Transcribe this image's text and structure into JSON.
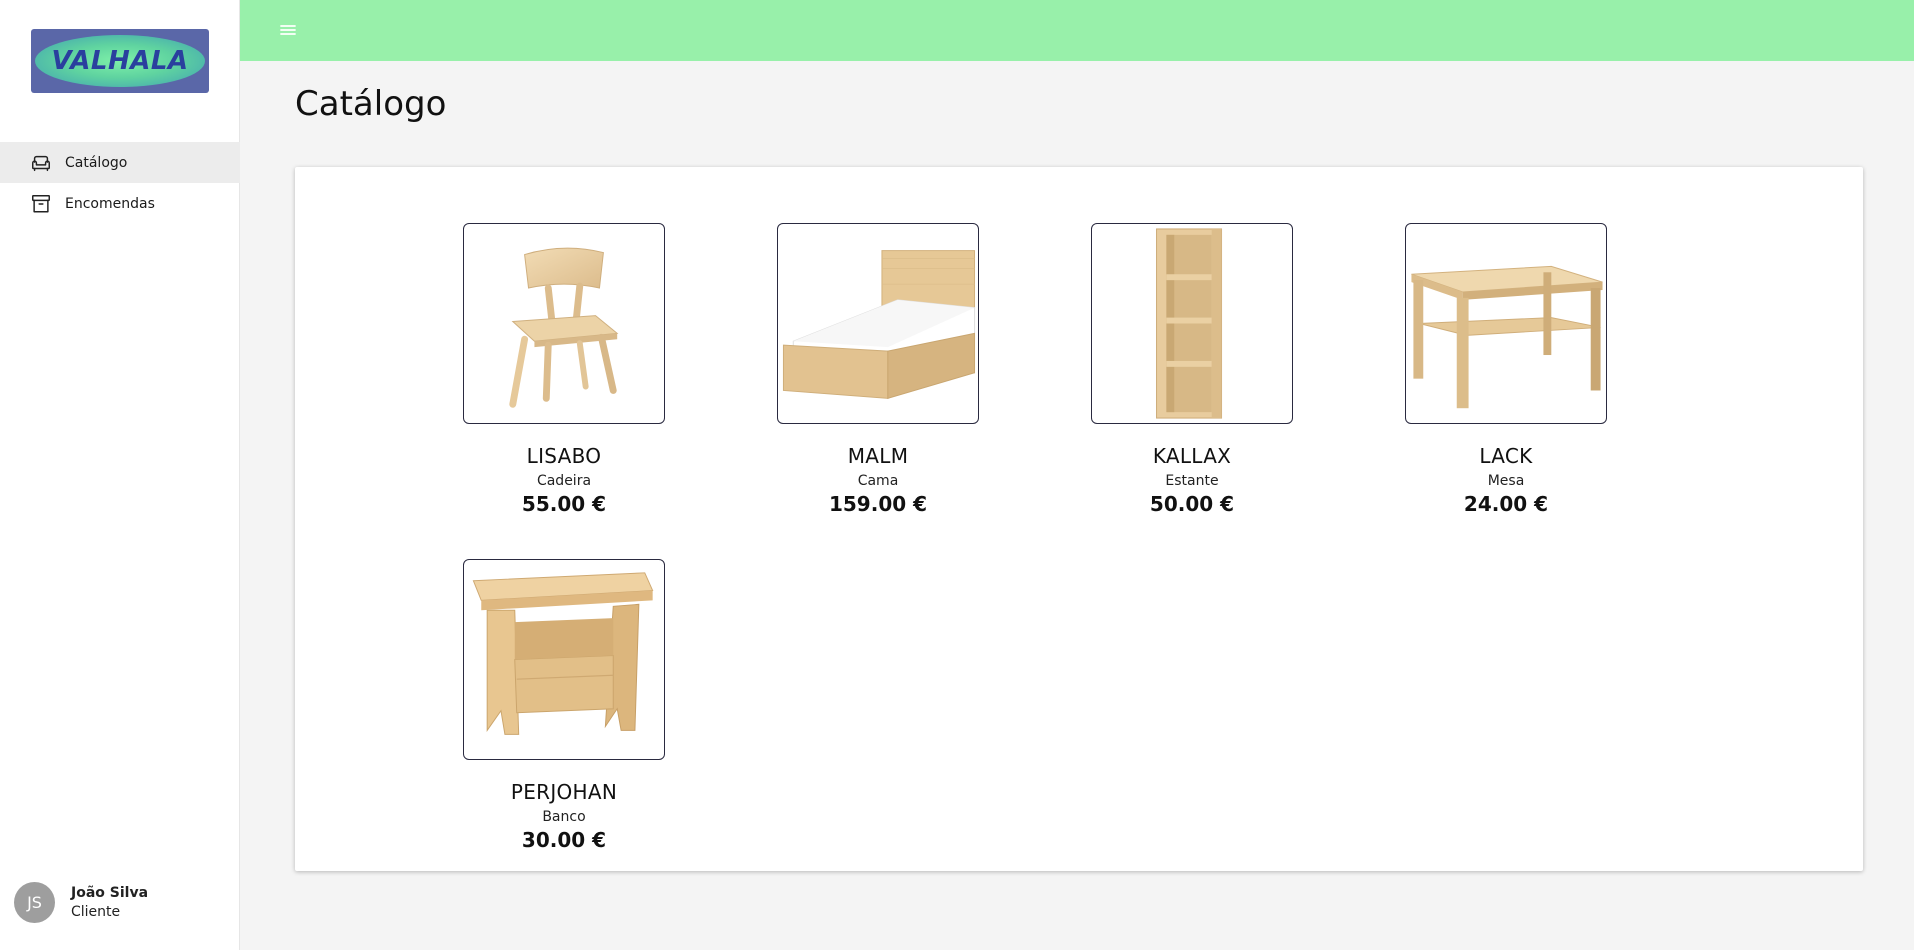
{
  "app": {
    "logo_text": "VALHALA",
    "accent_color": "#98f0aa",
    "logo_bg": "#5a67a8"
  },
  "sidebar": {
    "items": [
      {
        "label": "Catálogo",
        "icon": "sofa-icon",
        "active": true
      },
      {
        "label": "Encomendas",
        "icon": "archive-box-icon",
        "active": false
      }
    ]
  },
  "user": {
    "initials": "JS",
    "name": "João Silva",
    "role": "Cliente"
  },
  "header": {
    "menu_icon": "hamburger-menu-icon"
  },
  "page": {
    "title": "Catálogo"
  },
  "products": [
    {
      "name": "LISABO",
      "category": "Cadeira",
      "price": "55.00 €",
      "image": "chair"
    },
    {
      "name": "MALM",
      "category": "Cama",
      "price": "159.00 €",
      "image": "bed"
    },
    {
      "name": "KALLAX",
      "category": "Estante",
      "price": "50.00 €",
      "image": "shelf"
    },
    {
      "name": "LACK",
      "category": "Mesa",
      "price": "24.00 €",
      "image": "table"
    },
    {
      "name": "PERJOHAN",
      "category": "Banco",
      "price": "30.00 €",
      "image": "stool"
    }
  ]
}
